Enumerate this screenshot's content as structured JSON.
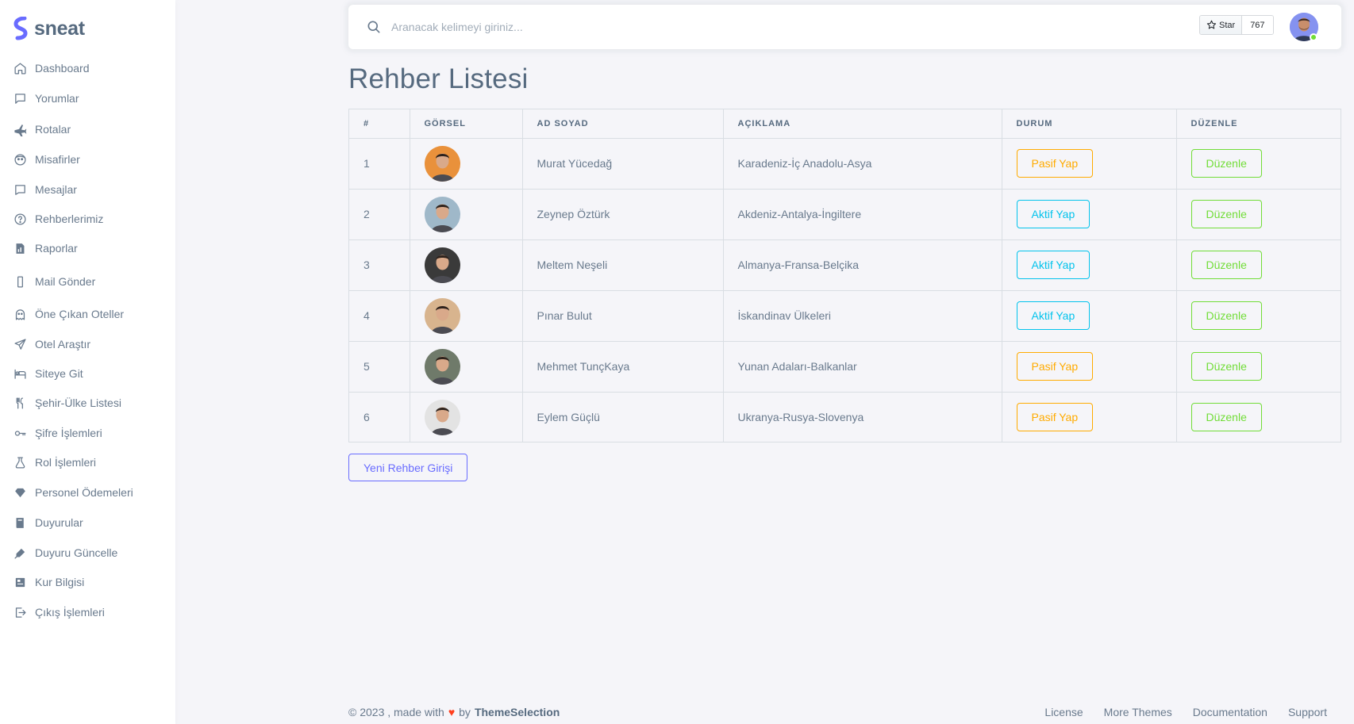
{
  "brand": {
    "name": "sneat",
    "accent": "#696cff"
  },
  "sidebar": {
    "items": [
      {
        "label": "Dashboard",
        "icon": "home-icon"
      },
      {
        "label": "Yorumlar",
        "icon": "comment-icon"
      },
      {
        "label": "Rotalar",
        "icon": "plane-icon"
      },
      {
        "label": "Misafirler",
        "icon": "guest-icon"
      },
      {
        "label": "Mesajlar",
        "icon": "message-icon"
      },
      {
        "label": "Rehberlerimiz",
        "icon": "help-circle-icon"
      },
      {
        "label": "Raporlar",
        "icon": "report-icon"
      },
      {
        "label": "Mail Gönder",
        "icon": "mobile-icon"
      },
      {
        "label": "Öne Çıkan Oteller",
        "icon": "ghost-icon"
      },
      {
        "label": "Otel Araştır",
        "icon": "send-icon"
      },
      {
        "label": "Siteye Git",
        "icon": "bed-icon"
      },
      {
        "label": "Şehir-Ülke Listesi",
        "icon": "restaurant-icon"
      },
      {
        "label": "Şifre İşlemleri",
        "icon": "key-icon"
      },
      {
        "label": "Rol İşlemleri",
        "icon": "flask-icon"
      },
      {
        "label": "Personel Ödemeleri",
        "icon": "diamond-icon"
      },
      {
        "label": "Duyurular",
        "icon": "book-icon"
      },
      {
        "label": "Duyuru Güncelle",
        "icon": "pen-icon"
      },
      {
        "label": "Kur Bilgisi",
        "icon": "news-icon"
      },
      {
        "label": "Çıkış İşlemleri",
        "icon": "log-out-icon"
      }
    ]
  },
  "navbar": {
    "search_placeholder": "Aranacak kelimeyi giriniz...",
    "star_label": "Star",
    "star_count": "767"
  },
  "page": {
    "title": "Rehber Listesi"
  },
  "table": {
    "headers": [
      "#",
      "GÖRSEL",
      "AD SOYAD",
      "AÇIKLAMA",
      "DURUM",
      "DÜZENLE"
    ],
    "rows": [
      {
        "num": "1",
        "name": "Murat Yücedağ",
        "desc": "Karadeniz-İç Anadolu-Asya",
        "status": "Pasif Yap",
        "status_type": "warning",
        "edit": "Düzenle",
        "avatar_color": "#e9913b"
      },
      {
        "num": "2",
        "name": "Zeynep Öztürk",
        "desc": "Akdeniz-Antalya-İngiltere",
        "status": "Aktif Yap",
        "status_type": "info",
        "edit": "Düzenle",
        "avatar_color": "#9fb8c9"
      },
      {
        "num": "3",
        "name": "Meltem Neşeli",
        "desc": "Almanya-Fransa-Belçika",
        "status": "Aktif Yap",
        "status_type": "info",
        "edit": "Düzenle",
        "avatar_color": "#3a3a3a"
      },
      {
        "num": "4",
        "name": "Pınar Bulut",
        "desc": "İskandinav Ülkeleri",
        "status": "Aktif Yap",
        "status_type": "info",
        "edit": "Düzenle",
        "avatar_color": "#d8b48e"
      },
      {
        "num": "5",
        "name": "Mehmet TunçKaya",
        "desc": "Yunan Adaları-Balkanlar",
        "status": "Pasif Yap",
        "status_type": "warning",
        "edit": "Düzenle",
        "avatar_color": "#6f7a6a"
      },
      {
        "num": "6",
        "name": "Eylem Güçlü",
        "desc": "Ukranya-Rusya-Slovenya",
        "status": "Pasif Yap",
        "status_type": "warning",
        "edit": "Düzenle",
        "avatar_color": "#e3e3e3"
      }
    ]
  },
  "actions": {
    "new_label": "Yeni Rehber Girişi"
  },
  "footer": {
    "copyright": "© 2023 , made with",
    "by": "by",
    "brand": "ThemeSelection",
    "links": [
      "License",
      "More Themes",
      "Documentation",
      "Support"
    ]
  }
}
